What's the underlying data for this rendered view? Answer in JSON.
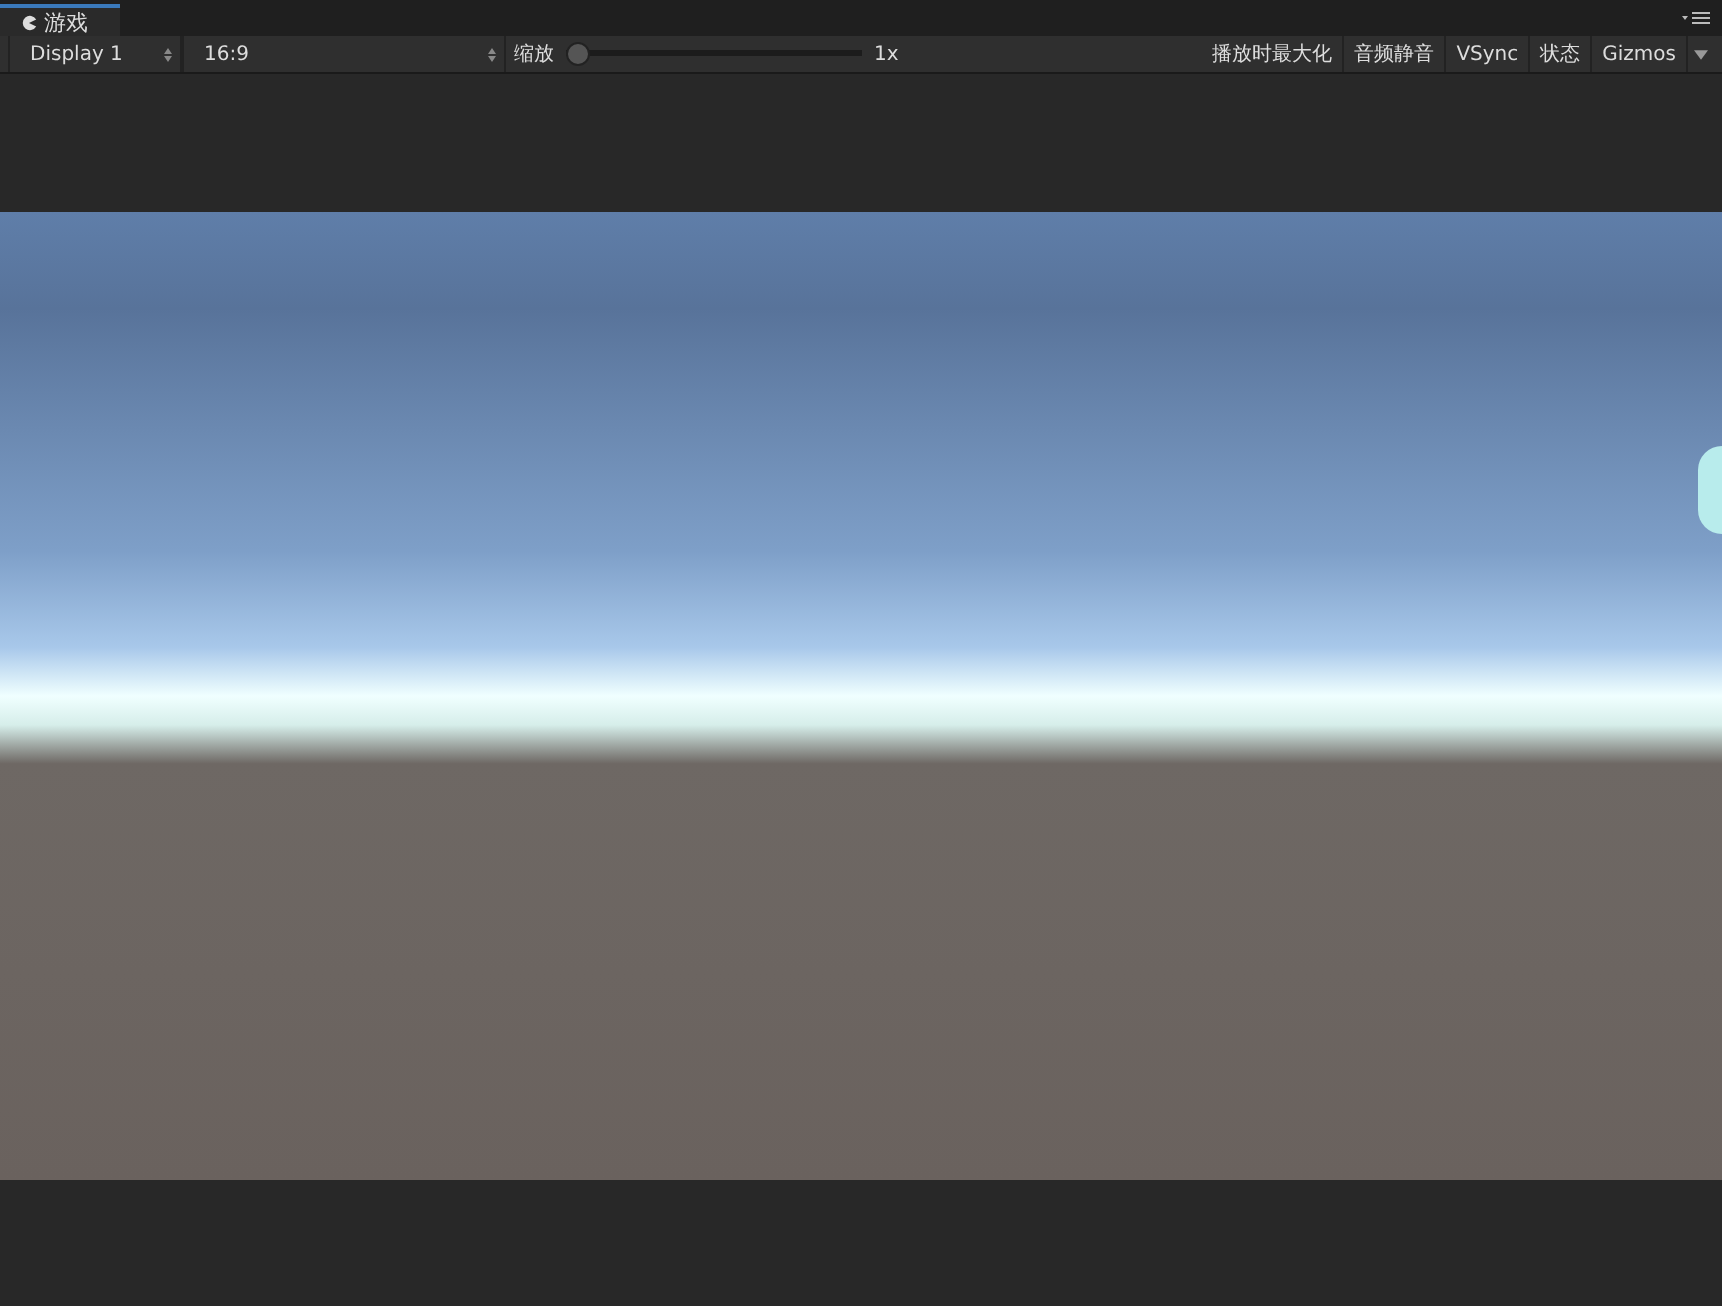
{
  "tab": {
    "label": "游戏"
  },
  "toolbar": {
    "display": "Display 1",
    "aspect": "16:9",
    "zoom_label": "缩放",
    "zoom": {
      "level": 0,
      "reading": "1x"
    },
    "toggles": [
      {
        "label": "播放时最大化"
      },
      {
        "label": "音频静音"
      },
      {
        "label": "VSync"
      },
      {
        "label": "状态"
      },
      {
        "label": "Gizmos"
      }
    ]
  }
}
